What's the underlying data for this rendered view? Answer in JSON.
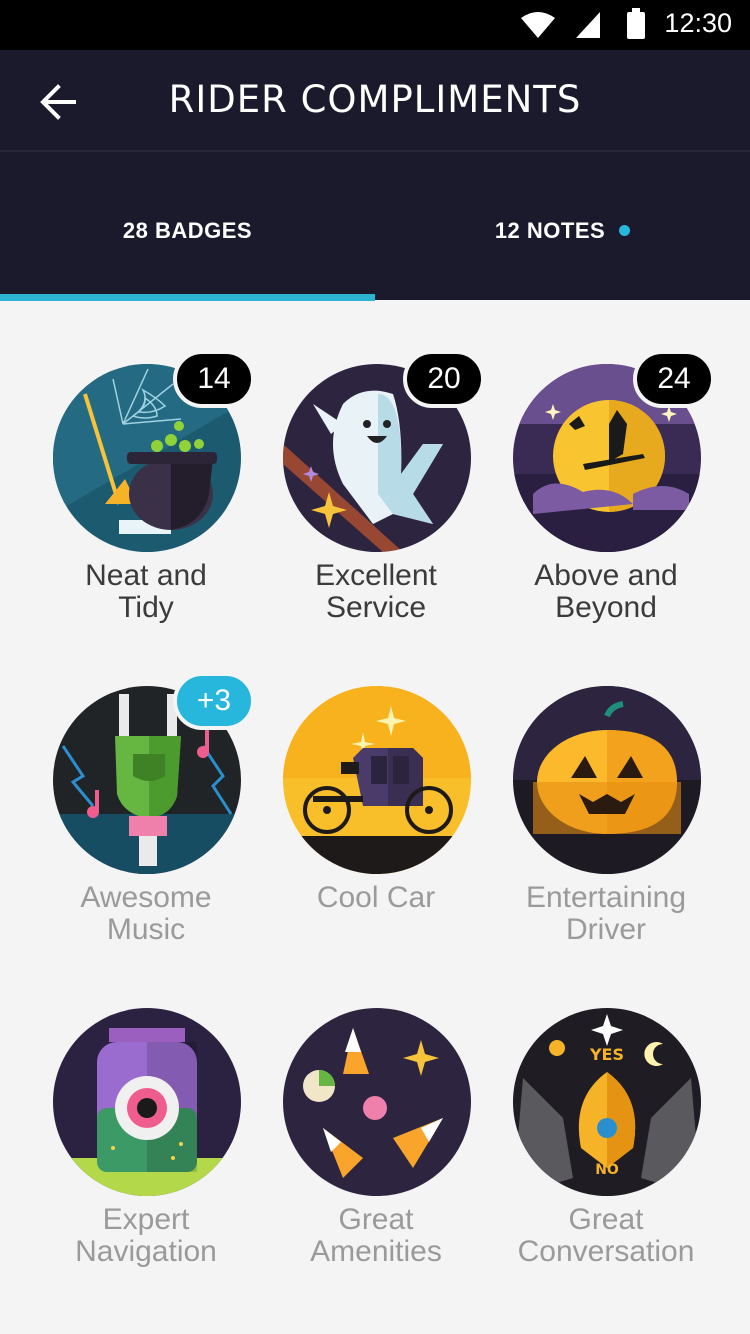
{
  "status_bar": {
    "time": "12:30"
  },
  "header": {
    "title": "RIDER COMPLIMENTS"
  },
  "tabs": [
    {
      "label": "28 BADGES",
      "active": true,
      "has_dot": false
    },
    {
      "label": "12 NOTES",
      "active": false,
      "has_dot": true
    }
  ],
  "badges": [
    {
      "line1": "Neat and",
      "line2": "Tidy",
      "count": "14",
      "earned": true,
      "icon": "cauldron-broom-icon"
    },
    {
      "line1": "Excellent",
      "line2": "Service",
      "count": "20",
      "earned": true,
      "icon": "ghost-icon"
    },
    {
      "line1": "Above and",
      "line2": "Beyond",
      "count": "24",
      "earned": true,
      "icon": "witch-moon-icon"
    },
    {
      "line1": "Awesome",
      "line2": "Music",
      "count": "+3",
      "earned": false,
      "icon": "zombie-hand-icon"
    },
    {
      "line1": "Cool Car",
      "line2": "",
      "count": "",
      "earned": false,
      "icon": "carriage-icon"
    },
    {
      "line1": "Entertaining",
      "line2": "Driver",
      "count": "",
      "earned": false,
      "icon": "pumpkin-icon"
    },
    {
      "line1": "Expert",
      "line2": "Navigation",
      "count": "",
      "earned": false,
      "icon": "eyeball-jar-icon"
    },
    {
      "line1": "Great",
      "line2": "Amenities",
      "count": "",
      "earned": false,
      "icon": "candy-icon"
    },
    {
      "line1": "Great",
      "line2": "Conversation",
      "count": "",
      "earned": false,
      "icon": "ouija-icon"
    }
  ],
  "colors": {
    "accent": "#2bb3d1",
    "header_bg": "#1a1a2c",
    "new_badge": "#27b6dc"
  }
}
